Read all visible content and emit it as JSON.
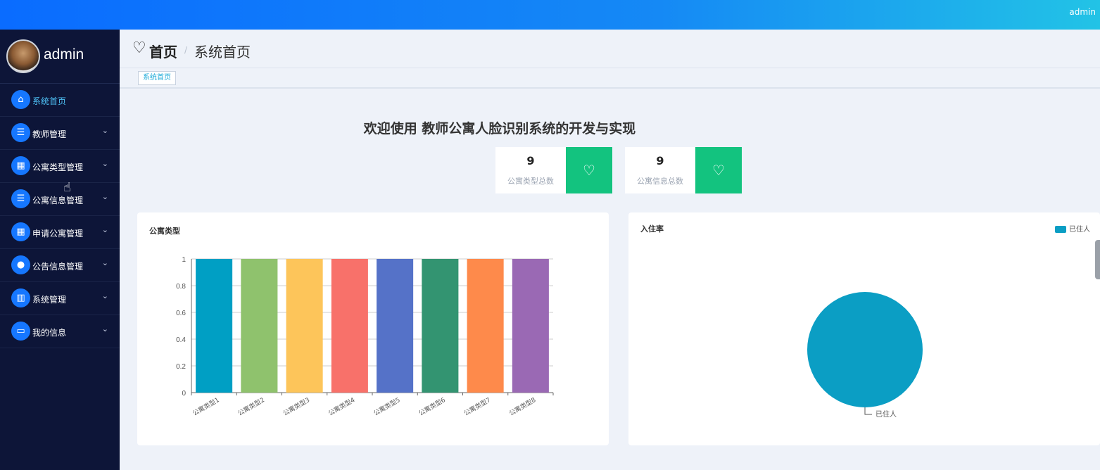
{
  "topbar": {
    "user": "admin"
  },
  "sidebar": {
    "username": "admin",
    "items": [
      {
        "label": "系统首页",
        "icon": "home-icon",
        "active": true,
        "expandable": false
      },
      {
        "label": "教师管理",
        "icon": "list-icon",
        "active": false,
        "expandable": true
      },
      {
        "label": "公寓类型管理",
        "icon": "grid-icon",
        "active": false,
        "expandable": true
      },
      {
        "label": "公寓信息管理",
        "icon": "list-icon",
        "active": false,
        "expandable": true
      },
      {
        "label": "申请公寓管理",
        "icon": "grid-icon",
        "active": false,
        "expandable": true
      },
      {
        "label": "公告信息管理",
        "icon": "user-icon",
        "active": false,
        "expandable": true
      },
      {
        "label": "系统管理",
        "icon": "book-icon",
        "active": false,
        "expandable": true
      },
      {
        "label": "我的信息",
        "icon": "card-icon",
        "active": false,
        "expandable": true
      }
    ]
  },
  "header": {
    "title": "首页",
    "separator": "/",
    "subtitle": "系统首页"
  },
  "tabs": [
    {
      "label": "系统首页"
    }
  ],
  "welcome": "欢迎使用 教师公寓人脸识别系统的开发与实现",
  "stats": [
    {
      "value": "9",
      "label": "公寓类型总数"
    },
    {
      "value": "9",
      "label": "公寓信息总数"
    }
  ],
  "chart_data": [
    {
      "type": "bar",
      "title": "公寓类型",
      "categories": [
        "公寓类型1",
        "公寓类型2",
        "公寓类型3",
        "公寓类型4",
        "公寓类型5",
        "公寓类型6",
        "公寓类型7",
        "公寓类型8"
      ],
      "values": [
        1,
        1,
        1,
        1,
        1,
        1,
        1,
        1
      ],
      "ylim": [
        0,
        1
      ],
      "yticks": [
        "0",
        "0.2",
        "0.4",
        "0.6",
        "0.8",
        "1"
      ],
      "colors": [
        "#009fc4",
        "#8fc26d",
        "#fdc55a",
        "#f8716a",
        "#5572c8",
        "#339471",
        "#fe8a4b",
        "#9a69b4"
      ],
      "grid": true
    },
    {
      "type": "pie",
      "title": "入住率",
      "slices": [
        {
          "name": "已住人",
          "value": 100
        }
      ],
      "colors": [
        "#0b9ec4"
      ],
      "legend": "top-right"
    }
  ]
}
